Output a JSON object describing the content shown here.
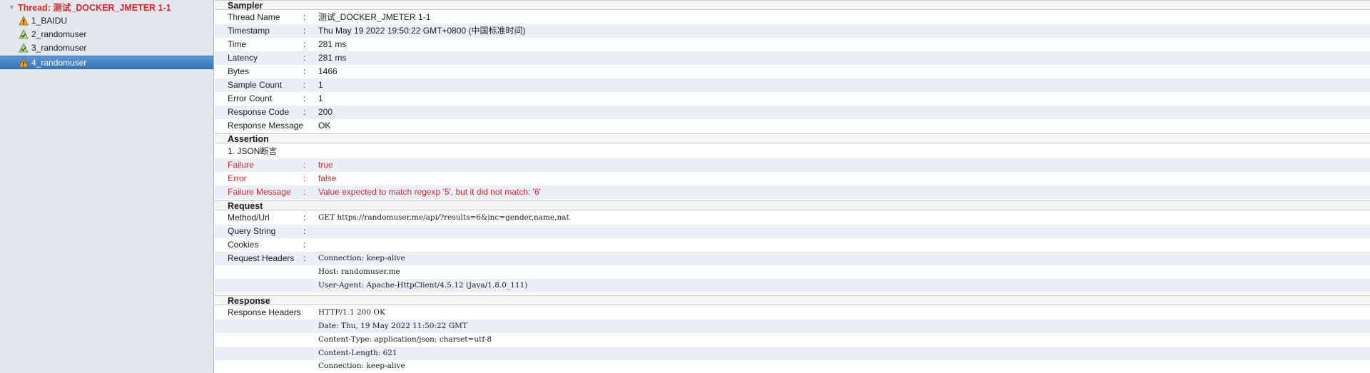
{
  "tree": {
    "root": {
      "label": "Thread: 测试_DOCKER_JMETER 1-1",
      "toggle": "▼"
    },
    "items": [
      {
        "label": "1_BAIDU",
        "status": "warning"
      },
      {
        "label": "2_randomuser",
        "status": "ok"
      },
      {
        "label": "3_randomuser",
        "status": "ok"
      },
      {
        "label": "4_randomuser",
        "status": "warning",
        "selected": true
      }
    ]
  },
  "sampler": {
    "header": "Sampler",
    "rows": [
      {
        "key": "Thread Name",
        "value": "测试_DOCKER_JMETER 1-1"
      },
      {
        "key": "Timestamp",
        "value": "Thu May 19 2022 19:50:22 GMT+0800 (中国标准时间)"
      },
      {
        "key": "Time",
        "value": "281 ms"
      },
      {
        "key": "Latency",
        "value": "281 ms"
      },
      {
        "key": "Bytes",
        "value": "1466"
      },
      {
        "key": "Sample Count",
        "value": "1"
      },
      {
        "key": "Error Count",
        "value": "1"
      },
      {
        "key": "Response Code",
        "value": "200"
      },
      {
        "key": "Response Message",
        "value": "OK"
      }
    ]
  },
  "assertion": {
    "header": "Assertion",
    "name": "1. JSON断言",
    "rows": [
      {
        "key": "Failure",
        "value": "true"
      },
      {
        "key": "Error",
        "value": "false"
      },
      {
        "key": "Failure Message",
        "value": "Value expected to match regexp '5', but it did not match: '6'"
      }
    ]
  },
  "request": {
    "header": "Request",
    "rows": [
      {
        "key": "Method/Url",
        "value": "GET https://randomuser.me/api/?results=6&inc=gender,name,nat"
      },
      {
        "key": "Query String",
        "value": ""
      },
      {
        "key": "Cookies",
        "value": ""
      },
      {
        "key": "Request Headers",
        "value": "Connection: keep-alive"
      },
      {
        "key": "",
        "value": "Host: randomuser.me"
      },
      {
        "key": "",
        "value": "User-Agent: Apache-HttpClient/4.5.12 (Java/1.8.0_111)"
      }
    ]
  },
  "response": {
    "header": "Response",
    "rows": [
      {
        "key": "Response Headers",
        "value": "HTTP/1.1 200 OK"
      },
      {
        "key": "",
        "value": "Date: Thu, 19 May 2022 11:50:22 GMT"
      },
      {
        "key": "",
        "value": "Content-Type: application/json; charset=utf-8"
      },
      {
        "key": "",
        "value": "Content-Length: 621"
      },
      {
        "key": "",
        "value": "Connection: keep-alive"
      }
    ]
  },
  "colon": ":",
  "colors": {
    "error_red": "#e0242a",
    "selection_blue": "#3b73b6",
    "alt_row": "#ebf0f8"
  }
}
